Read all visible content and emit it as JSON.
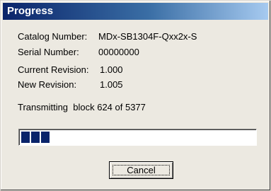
{
  "window": {
    "title": "Progress"
  },
  "info": {
    "catalog_number_label": "Catalog Number:",
    "catalog_number": "MDx-SB1304F-Qxx2x-S",
    "serial_number_label": "Serial Number:",
    "serial_number": "00000000",
    "current_revision_label": "Current Revision:",
    "current_revision": "1.000",
    "new_revision_label": "New Revision:",
    "new_revision": "1.005"
  },
  "status": {
    "text": "Transmitting  block 624 of 5377"
  },
  "progress": {
    "fraction": 0.116,
    "fill_color": "#0a246a"
  },
  "buttons": {
    "cancel_label": "Cancel"
  }
}
